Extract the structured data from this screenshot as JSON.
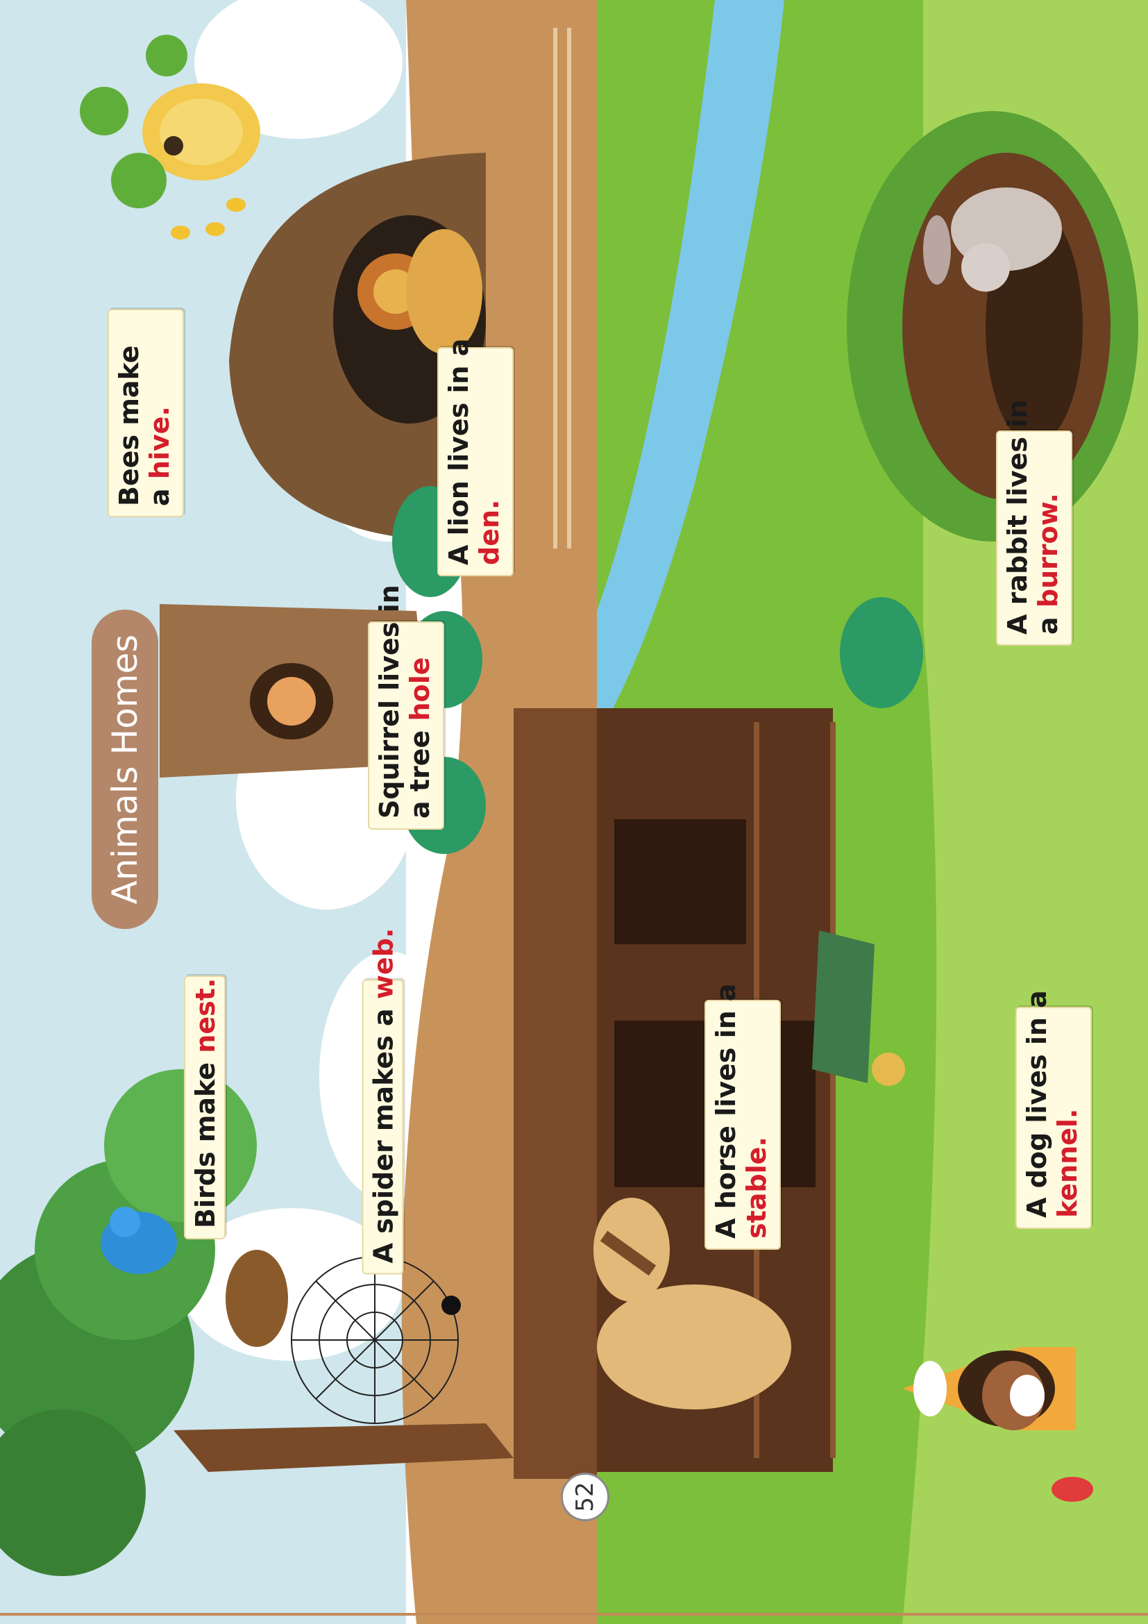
{
  "page": {
    "title": "Animals Homes",
    "page_number": "52"
  },
  "captions": {
    "bees": {
      "line1": "Bees make",
      "line2_prefix": "a ",
      "home": "hive."
    },
    "lion": {
      "line1": "A lion lives in a",
      "home": "den."
    },
    "squirrel": {
      "line1": "Squirrel lives in",
      "line2_prefix": "a tree ",
      "home": "hole"
    },
    "birds": {
      "line1_prefix": "Birds make ",
      "home": "nest."
    },
    "spider": {
      "line1_prefix": "A spider makes a ",
      "home": "web."
    },
    "horse": {
      "line1": "A horse lives in a",
      "home": "stable."
    },
    "rabbit": {
      "line1": "A rabbit lives in",
      "line2_prefix": "a ",
      "home": "burrow."
    },
    "dog": {
      "line1": "A dog lives in a",
      "home": "kennel."
    }
  },
  "colors": {
    "highlight": "#d41e2b",
    "title_pill": "#b4876a",
    "sky": "#cfe6ec",
    "grass": "#8cc63f",
    "dirt": "#c8935a",
    "wood": "#6b3f22",
    "river": "#7cc8e8"
  },
  "icons": [
    "beehive-icon",
    "bee-icon",
    "cave-icon",
    "lion-icon",
    "tree-icon",
    "squirrel-icon",
    "bird-icon",
    "nest-icon",
    "spider-web-icon",
    "spider-icon",
    "stable-icon",
    "horse-icon",
    "wheelbarrow-icon",
    "fence-icon",
    "river-icon",
    "bush-icon",
    "burrow-icon",
    "rabbit-icon",
    "kennel-icon",
    "dog-icon",
    "dog-bowl-icon"
  ]
}
